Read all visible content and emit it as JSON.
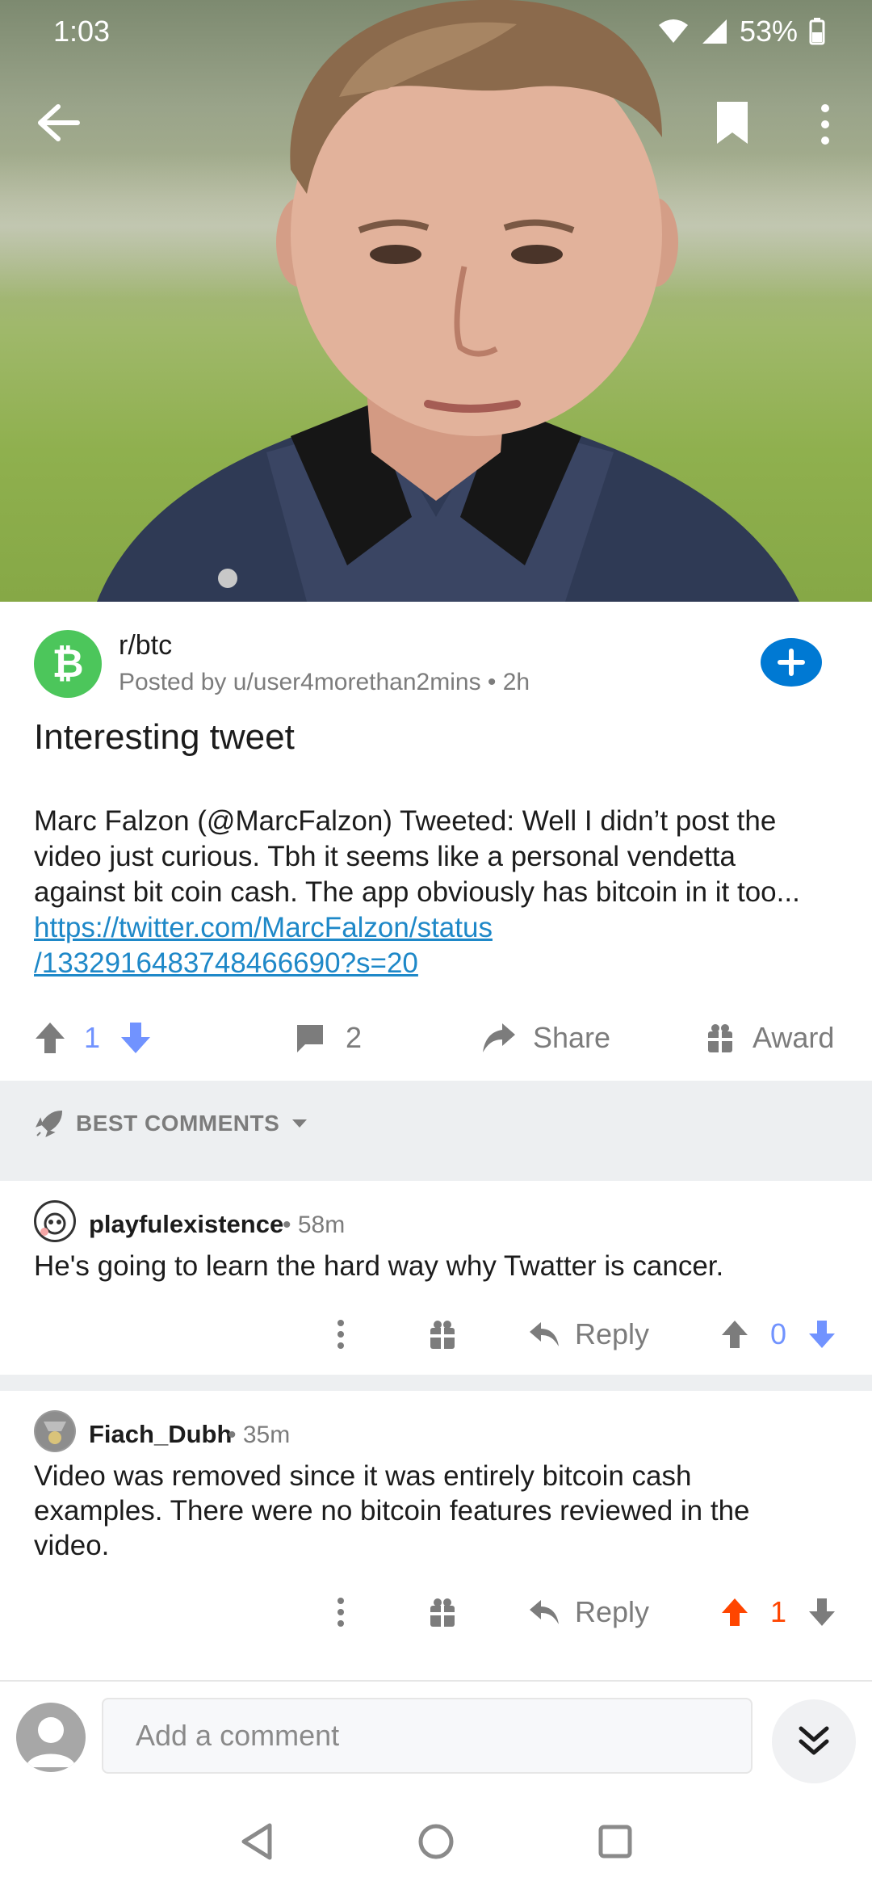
{
  "status_bar": {
    "time": "1:03",
    "battery": "53%"
  },
  "toolbar": {
    "back_icon": "arrow-left-icon",
    "bookmark_icon": "bookmark-icon",
    "more_icon": "more-vertical-icon"
  },
  "post": {
    "subreddit": "r/btc",
    "meta": "Posted by u/user4morethan2mins • 2h",
    "title": "Interesting tweet",
    "body": "Marc Falzon (@MarcFalzon) Tweeted: Well I didn’t post the video just curious. Tbh it seems like a personal vendetta against bit coin cash. The app obviously has bitcoin in it too... ",
    "link_line1": "https://twitter.com/MarcFalzon/status",
    "link_line2": "/1332916483748466690?s=20",
    "score": "1",
    "comments": "2",
    "share_label": "Share",
    "award_label": "Award"
  },
  "sort": {
    "label": "BEST COMMENTS"
  },
  "comments": [
    {
      "author": "playfulexistence",
      "time": "• 58m",
      "text": "He's going to learn the hard way why Twatter is cancer.",
      "reply_label": "Reply",
      "score": "0",
      "vote_state": "none"
    },
    {
      "author": "Fiach_Dubh",
      "time": "• 35m",
      "text": "Video was removed since it was entirely bitcoin cash examples. There were no bitcoin features reviewed in the video.",
      "reply_label": "Reply",
      "score": "1",
      "vote_state": "upvoted"
    }
  ],
  "composer": {
    "placeholder": "Add a comment"
  },
  "colors": {
    "upvote_active": "#ff4500",
    "downvote": "#7193ff",
    "join_blue": "#0079d3",
    "subreddit_green": "#4cc65b"
  }
}
